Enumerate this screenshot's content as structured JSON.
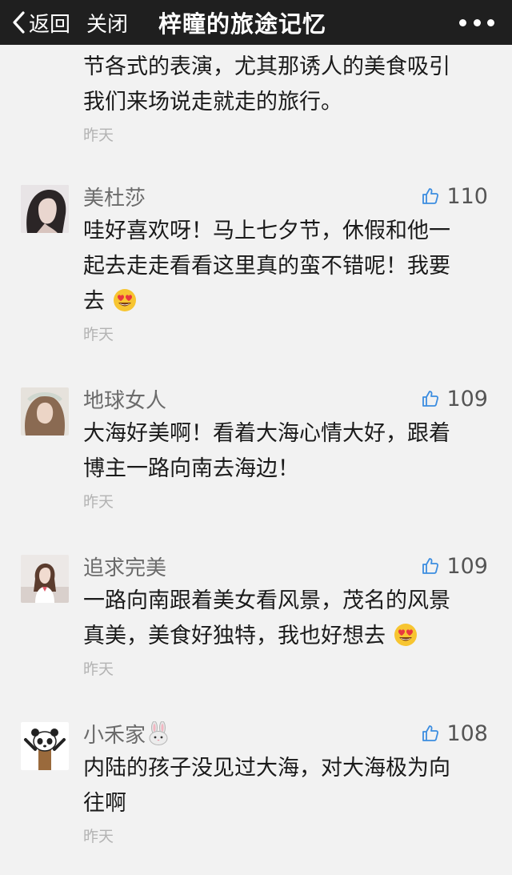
{
  "nav": {
    "back_label": "返回",
    "close_label": "关闭",
    "title": "梓瞳的旅途记忆"
  },
  "partial_comment": {
    "lines": [
      "节各式的表演，尤其那诱人的美食吸引",
      "我们来场说走就走的旅行。"
    ],
    "time": "昨天"
  },
  "comments": [
    {
      "nickname": "美杜莎",
      "likes": "110",
      "lines": [
        "哇好喜欢呀！马上七夕节，休假和他一",
        "起去走走看看这里真的蛮不错呢！我要",
        "去"
      ],
      "emoji": "heart-eyes",
      "time": "昨天"
    },
    {
      "nickname": "地球女人",
      "likes": "109",
      "lines": [
        "大海好美啊！看着大海心情大好，跟着",
        "博主一路向南去海边！"
      ],
      "time": "昨天"
    },
    {
      "nickname": "追求完美",
      "likes": "109",
      "lines": [
        "一路向南跟着美女看风景，茂名的风景",
        "真美，美食好独特，我也好想去"
      ],
      "emoji": "heart-eyes",
      "time": "昨天"
    },
    {
      "nickname": "小禾家",
      "nickname_emoji": "rabbit-face",
      "likes": "108",
      "lines": [
        "内陆的孩子没见过大海，对大海极为向",
        "往啊"
      ],
      "time": "昨天"
    }
  ]
}
